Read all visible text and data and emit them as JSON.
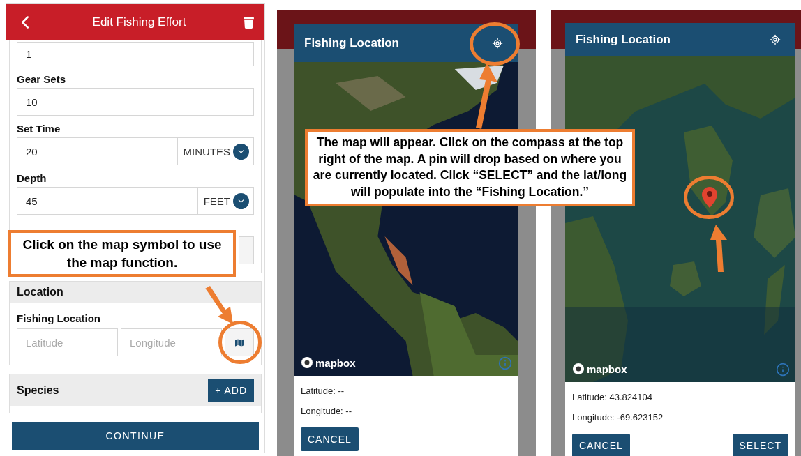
{
  "form_screen": {
    "title": "Edit Fishing Effort",
    "fields": [
      {
        "value": "1"
      },
      {
        "label": "Gear Sets",
        "value": "10"
      },
      {
        "label": "Set Time",
        "value": "20",
        "unit": "MINUTES"
      },
      {
        "label": "Depth",
        "value": "45",
        "unit": "FEET"
      }
    ],
    "location_section": {
      "title": "Location",
      "label": "Fishing Location",
      "latitude_placeholder": "Latitude",
      "longitude_placeholder": "Longitude"
    },
    "species_section": {
      "title": "Species",
      "add_button": "+ ADD"
    },
    "continue_button": "CONTINUE"
  },
  "map_screens": [
    {
      "title": "Fishing Location",
      "kind": "world",
      "pin_dropped": false,
      "attribution": "mapbox",
      "latitude": "Latitude: --",
      "longitude": "Longitude: --",
      "buttons": [
        "CANCEL"
      ]
    },
    {
      "title": "Fishing Location",
      "kind": "coast",
      "pin_dropped": true,
      "attribution": "mapbox",
      "latitude": "Latitude: 43.824104",
      "longitude": "Longitude: -69.623152",
      "buttons": [
        "CANCEL",
        "SELECT"
      ]
    }
  ],
  "callouts": [
    {
      "text": "Click on the map symbol to use the map function."
    },
    {
      "text": "The map will appear. Click on the compass at the top right of the map. A pin will drop based on where you are currently located. Click “SELECT” and the lat/long will populate into the “Fishing Location.”"
    }
  ]
}
